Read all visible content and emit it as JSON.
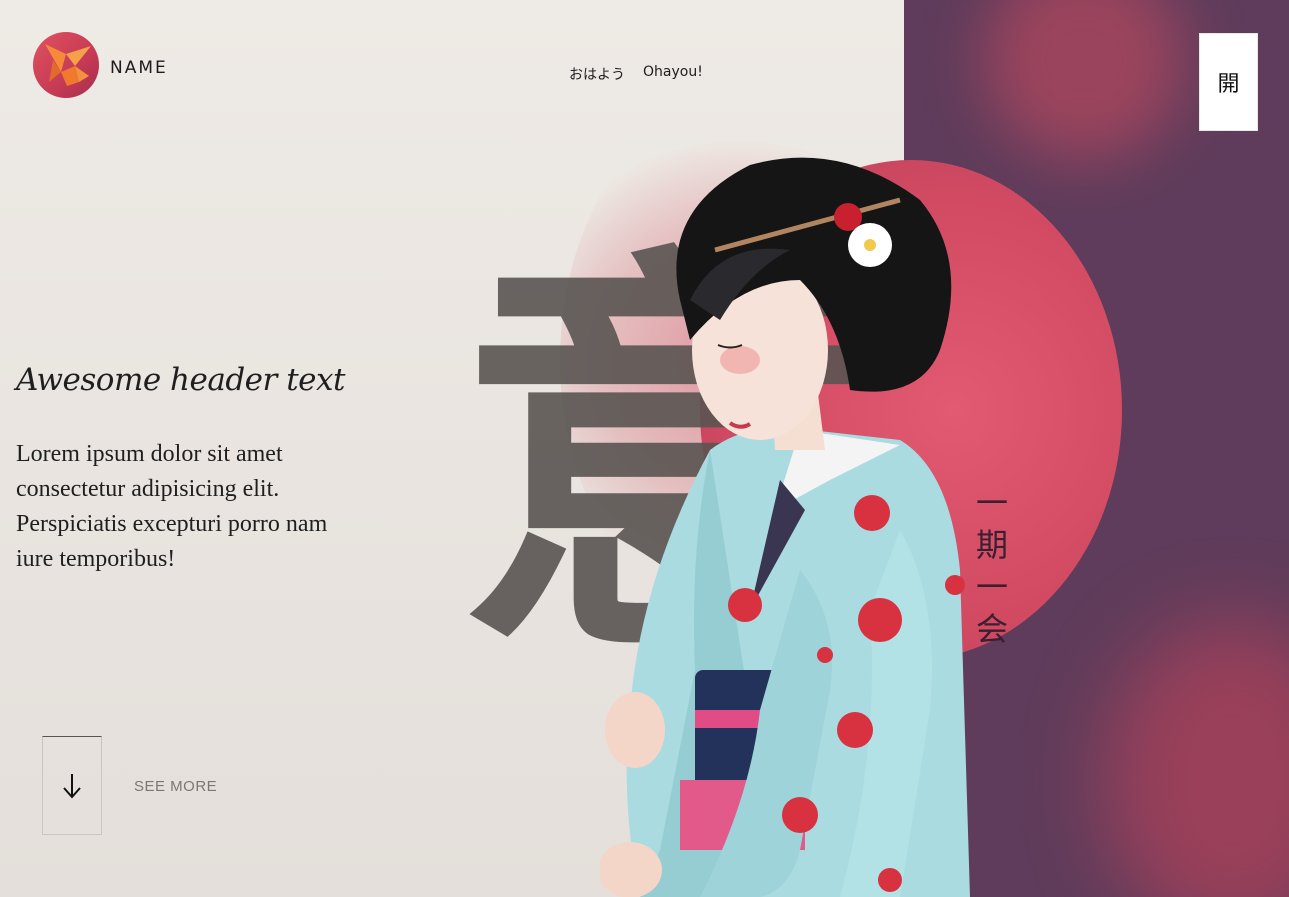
{
  "header": {
    "brand_name": "NAME",
    "greeting_jp": "おはよう",
    "greeting_romaji": "Ohayou!",
    "menu_label": "開"
  },
  "hero": {
    "title": "Awesome header text",
    "body": "Lorem ipsum dolor sit amet consectetur adipisicing elit. Perspiciatis excepturi porro nam iure temporibus!",
    "background_kanji": "意",
    "vertical_kanji": [
      "一",
      "期",
      "一",
      "会"
    ]
  },
  "scroll": {
    "see_more_label": "SEE MORE",
    "icon": "arrow-down-icon"
  },
  "colors": {
    "panel_purple": "#5f3c5b",
    "sun_red": "#d9516a",
    "logo_red": "#c63a55",
    "logo_bird_orange": "#f08a3a",
    "page_bg": "#ebe7e2"
  }
}
